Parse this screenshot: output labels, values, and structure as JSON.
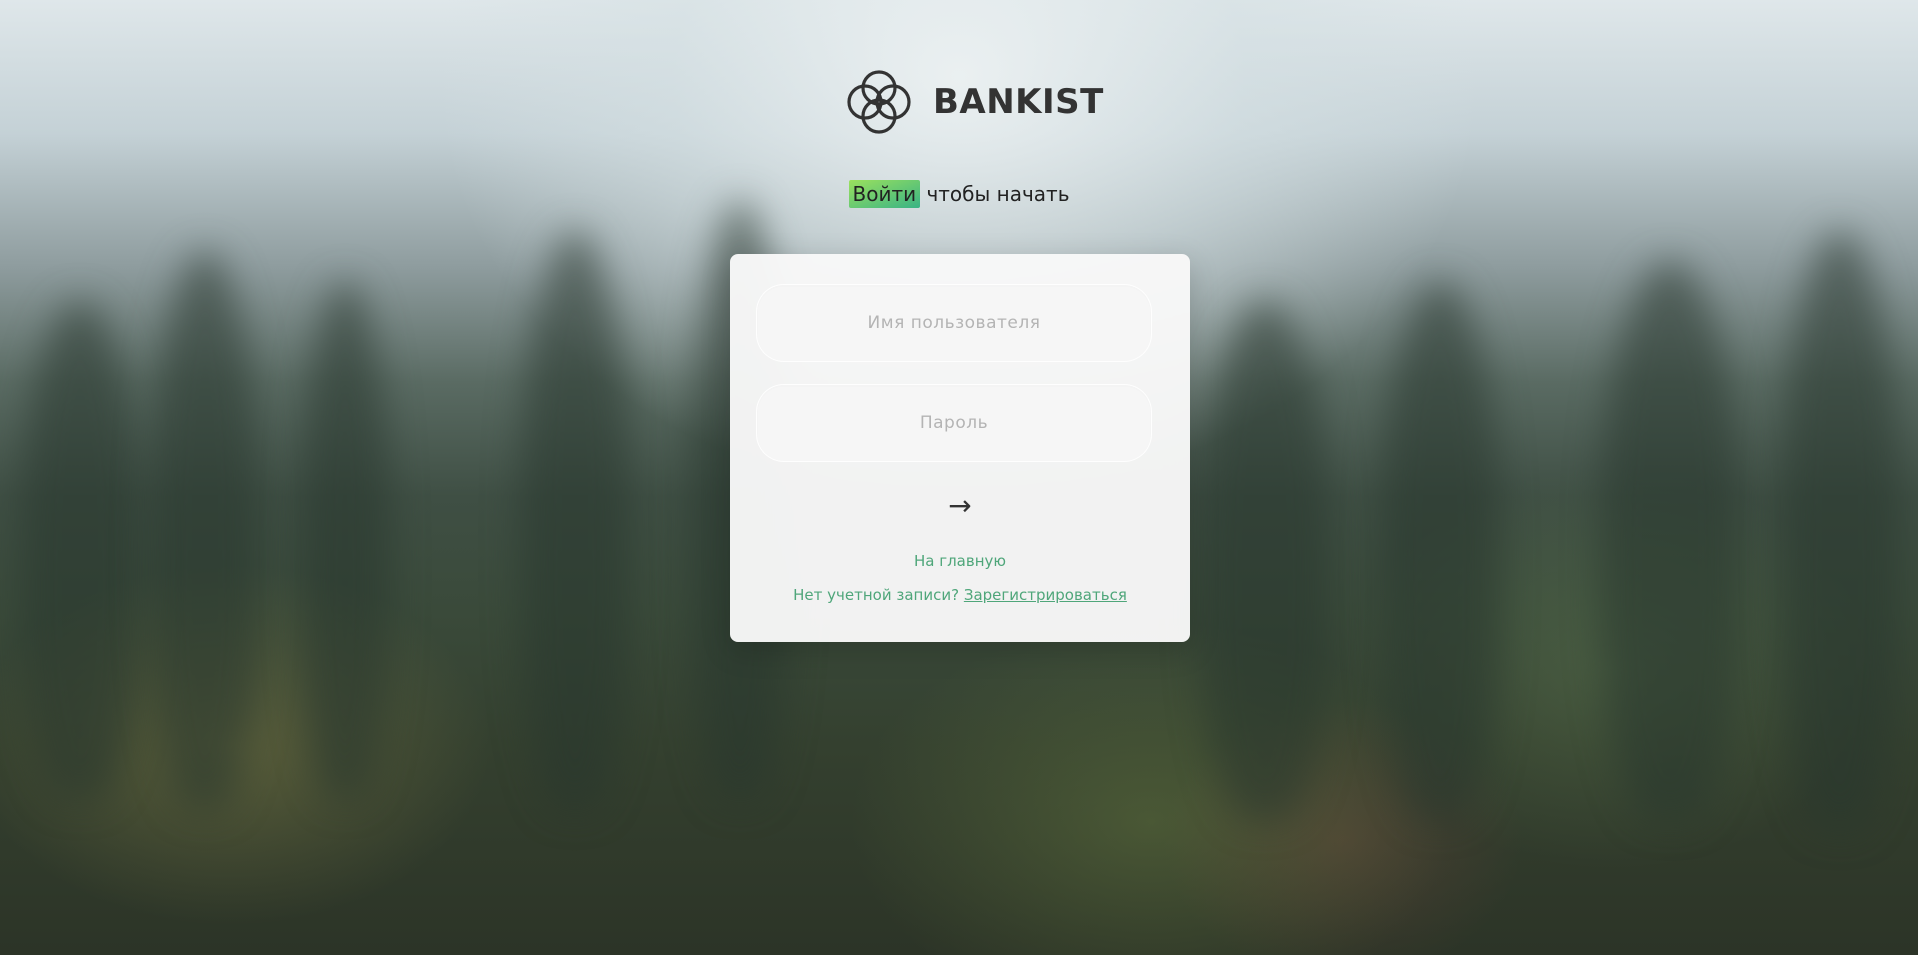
{
  "brand": {
    "name": "BANKIST",
    "logo_icon": "four-circles-logo-icon"
  },
  "welcome": {
    "highlight": "Войти",
    "rest": " чтобы начать",
    "highlight_color_start": "#9be15d",
    "highlight_color_end": "#39b385"
  },
  "form": {
    "username_placeholder": "Имя пользователя",
    "username_value": "",
    "password_placeholder": "Пароль",
    "password_value": "",
    "submit_label": "→"
  },
  "links": {
    "home": "На главную",
    "no_account": "Нет учетной записи?",
    "register": "Зарегистрироваться"
  },
  "colors": {
    "accent_green": "#4fa67a",
    "text_dark": "#333333",
    "card_bg": "#f8f8f8"
  }
}
